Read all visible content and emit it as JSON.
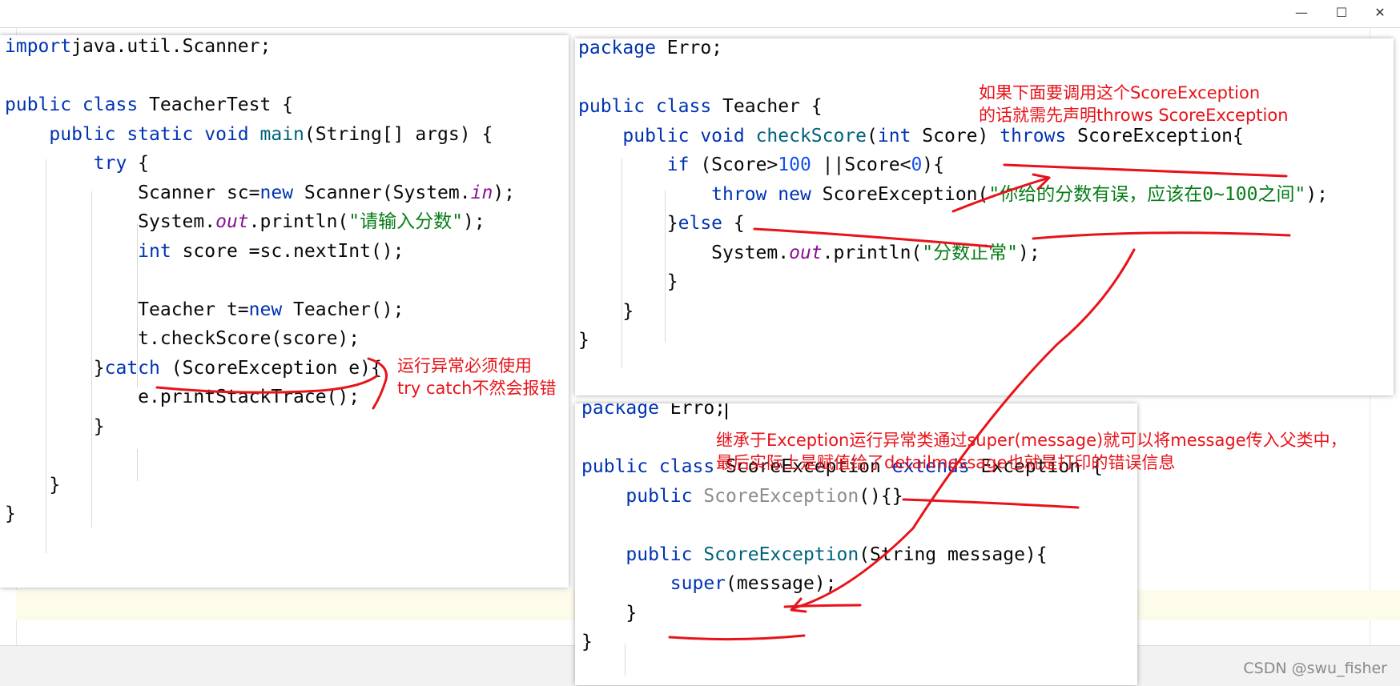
{
  "window": {
    "minimize_glyph": "—",
    "maximize_glyph": "☐",
    "close_glyph": "✕"
  },
  "left_editor": {
    "lines": [
      [
        [
          "kw",
          "import"
        ],
        [
          "",
          "java.util.Scanner;"
        ]
      ],
      [],
      [
        [
          "kw",
          "public class "
        ],
        [
          "",
          "TeacherTest {"
        ]
      ],
      [
        [
          "",
          "    "
        ],
        [
          "kw",
          "public static void "
        ],
        [
          "fn",
          "main"
        ],
        [
          "",
          "(String[] args) {"
        ]
      ],
      [
        [
          "",
          "        "
        ],
        [
          "kw",
          "try "
        ],
        [
          "",
          "{"
        ]
      ],
      [
        [
          "",
          "            Scanner sc="
        ],
        [
          "kw",
          "new "
        ],
        [
          "",
          "Scanner(System."
        ],
        [
          "fld",
          "in"
        ],
        [
          "",
          ");"
        ]
      ],
      [
        [
          "",
          "            System."
        ],
        [
          "fld",
          "out"
        ],
        [
          "",
          ".println("
        ],
        [
          "str",
          "\"请输入分数\""
        ],
        [
          "",
          ");"
        ]
      ],
      [
        [
          "",
          "            "
        ],
        [
          "kw",
          "int "
        ],
        [
          "",
          "score =sc.nextInt();"
        ]
      ],
      [],
      [
        [
          "",
          "            Teacher t="
        ],
        [
          "kw",
          "new "
        ],
        [
          "",
          "Teacher();"
        ]
      ],
      [
        [
          "",
          "            t.checkScore(score);"
        ]
      ],
      [
        [
          "",
          "        }"
        ],
        [
          "kw",
          "catch "
        ],
        [
          "",
          "(ScoreException e){"
        ]
      ],
      [
        [
          "",
          "            e.printStackTrace();"
        ]
      ],
      [
        [
          "",
          "        }"
        ]
      ],
      [],
      [
        [
          "",
          "    }"
        ]
      ],
      [
        [
          "",
          "}"
        ]
      ]
    ]
  },
  "teacher_editor": {
    "lines": [
      [
        [
          "kw",
          "package "
        ],
        [
          "",
          "Erro;"
        ]
      ],
      [],
      [
        [
          "kw",
          "public class "
        ],
        [
          "",
          "Teacher {"
        ]
      ],
      [
        [
          "",
          "    "
        ],
        [
          "kw",
          "public void "
        ],
        [
          "fn",
          "checkScore"
        ],
        [
          "",
          "("
        ],
        [
          "kw",
          "int "
        ],
        [
          "",
          "Score) "
        ],
        [
          "kw",
          "throws "
        ],
        [
          "",
          "ScoreException{"
        ]
      ],
      [
        [
          "",
          "        "
        ],
        [
          "kw",
          "if "
        ],
        [
          "",
          "(Score>"
        ],
        [
          "num",
          "100 "
        ],
        [
          "",
          "||Score<"
        ],
        [
          "num",
          "0"
        ],
        [
          "",
          "){"
        ]
      ],
      [
        [
          "",
          "            "
        ],
        [
          "kw",
          "throw new "
        ],
        [
          "",
          "ScoreException("
        ],
        [
          "str",
          "\"你给的分数有误，应该在0~100之间\""
        ],
        [
          "",
          ");"
        ]
      ],
      [
        [
          "",
          "        }"
        ],
        [
          "kw",
          "else "
        ],
        [
          "",
          "{"
        ]
      ],
      [
        [
          "",
          "            System."
        ],
        [
          "fld",
          "out"
        ],
        [
          "",
          ".println("
        ],
        [
          "str",
          "\"分数正常\""
        ],
        [
          "",
          ");"
        ]
      ],
      [
        [
          "",
          "        }"
        ]
      ],
      [
        [
          "",
          "    }"
        ]
      ],
      [
        [
          "",
          "}"
        ]
      ]
    ]
  },
  "exception_editor": {
    "lines": [
      [
        [
          "kw",
          "package "
        ],
        [
          "",
          "Erro;"
        ]
      ],
      [],
      [
        [
          "kw",
          "public class "
        ],
        [
          "",
          "ScoreException "
        ],
        [
          "kw",
          "extends "
        ],
        [
          "",
          "Exception {"
        ]
      ],
      [
        [
          "",
          "    "
        ],
        [
          "kw",
          "public "
        ],
        [
          "gray",
          "ScoreException"
        ],
        [
          "",
          "(){}"
        ]
      ],
      [],
      [
        [
          "",
          "    "
        ],
        [
          "kw",
          "public "
        ],
        [
          "fn",
          "ScoreException"
        ],
        [
          "",
          "(String message){"
        ]
      ],
      [
        [
          "",
          "        "
        ],
        [
          "kw",
          "super"
        ],
        [
          "",
          "(message);"
        ]
      ],
      [
        [
          "",
          "    }"
        ]
      ],
      [
        [
          "",
          "}"
        ]
      ]
    ]
  },
  "annotations": {
    "try_catch_note": "运行异常必须使用\ntry catch不然会报错",
    "throws_note": "如果下面要调用这个ScoreException\n的话就需先声明throws ScoreException",
    "super_note": "继承于Exception运行异常类通过super(message)就可以将message传入父类中，\n最后实际上是赋值给了detailmessage也就是打印的错误信息"
  },
  "watermark": "CSDN @swu_fisher",
  "colors": {
    "keyword": "#0033b3",
    "method": "#00627a",
    "number": "#1750eb",
    "string": "#067d17",
    "field": "#871094",
    "annotation": "#e8131a"
  }
}
